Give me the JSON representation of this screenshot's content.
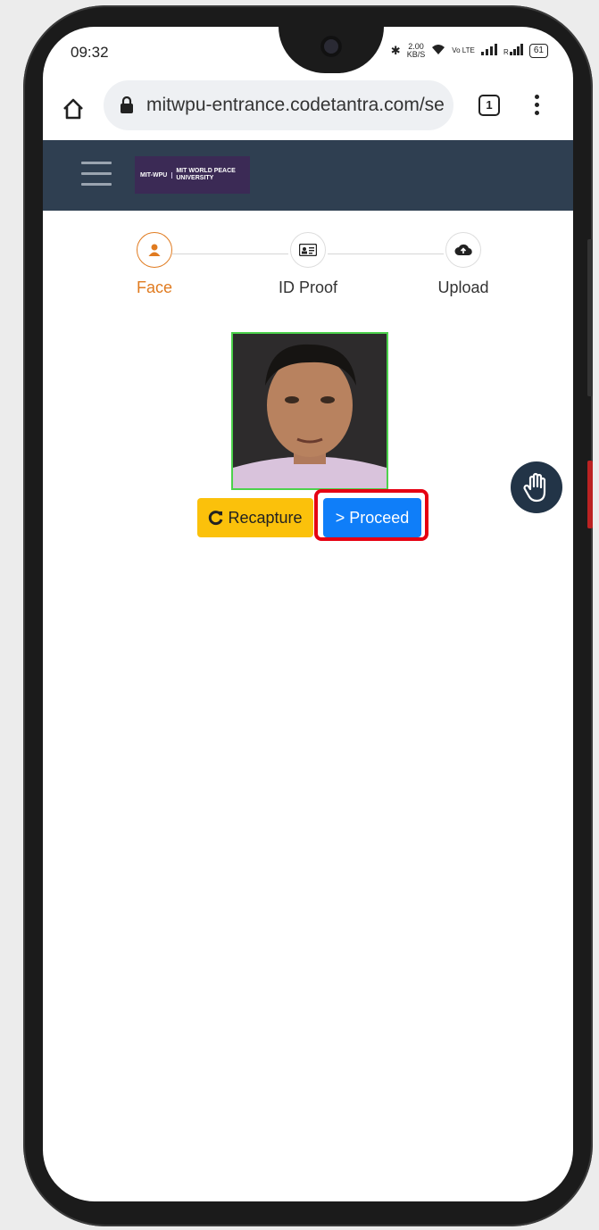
{
  "status_bar": {
    "time": "09:32",
    "net_speed": "2.00",
    "net_speed_unit": "KB/S",
    "volte": "Vo LTE",
    "battery": "61"
  },
  "browser": {
    "url": "mitwpu-entrance.codetantra.com/se",
    "tab_count": "1"
  },
  "app_header": {
    "logo_short": "MIT-WPU",
    "logo_name": "MIT WORLD PEACE",
    "logo_sub": "UNIVERSITY"
  },
  "stepper": {
    "steps": [
      {
        "label": "Face",
        "icon": "user-icon",
        "active": true
      },
      {
        "label": "ID Proof",
        "icon": "id-card-icon",
        "active": false
      },
      {
        "label": "Upload",
        "icon": "cloud-upload-icon",
        "active": false
      }
    ],
    "active_color": "#e07b20"
  },
  "actions": {
    "recapture_label": "Recapture",
    "proceed_label": "> Proceed"
  },
  "colors": {
    "header_bg": "#2f3f51",
    "recapture_bg": "#fbc10b",
    "proceed_bg": "#0f7ef9",
    "highlight": "#e60012",
    "photo_border": "#4cd14c"
  }
}
